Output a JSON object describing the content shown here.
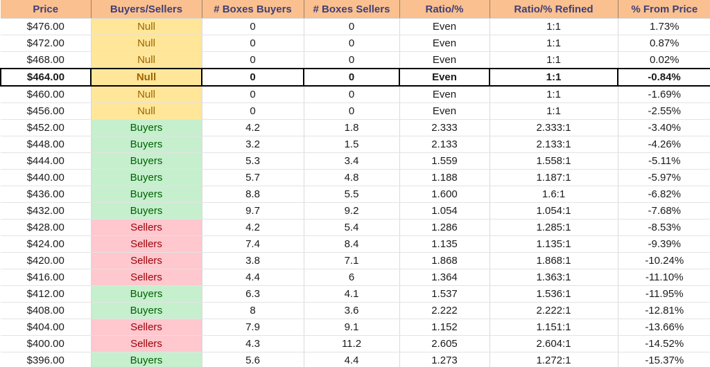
{
  "table": {
    "headers": [
      "Price",
      "Buyers/Sellers",
      "# Boxes Buyers",
      "# Boxes Sellers",
      "Ratio/%",
      "Ratio/% Refined",
      "% From Price"
    ],
    "colors": {
      "header_fill": "#FAC090",
      "header_text": "#3F3F76",
      "null_fill": "#FFE699",
      "null_text": "#9C6500",
      "buyers_fill": "#C6EFCE",
      "buyers_text": "#006100",
      "sellers_fill": "#FFC7CE",
      "sellers_text": "#9C0006",
      "highlight_border": "#000000"
    },
    "rows": [
      {
        "price": "$476.00",
        "status": "Null",
        "status_kind": "null",
        "boxes_buyers": "0",
        "boxes_sellers": "0",
        "ratio": "Even",
        "ratio_refined": "1:1",
        "from_price": "1.73%",
        "highlight": false
      },
      {
        "price": "$472.00",
        "status": "Null",
        "status_kind": "null",
        "boxes_buyers": "0",
        "boxes_sellers": "0",
        "ratio": "Even",
        "ratio_refined": "1:1",
        "from_price": "0.87%",
        "highlight": false
      },
      {
        "price": "$468.00",
        "status": "Null",
        "status_kind": "null",
        "boxes_buyers": "0",
        "boxes_sellers": "0",
        "ratio": "Even",
        "ratio_refined": "1:1",
        "from_price": "0.02%",
        "highlight": false
      },
      {
        "price": "$464.00",
        "status": "Null",
        "status_kind": "null",
        "boxes_buyers": "0",
        "boxes_sellers": "0",
        "ratio": "Even",
        "ratio_refined": "1:1",
        "from_price": "-0.84%",
        "highlight": true
      },
      {
        "price": "$460.00",
        "status": "Null",
        "status_kind": "null",
        "boxes_buyers": "0",
        "boxes_sellers": "0",
        "ratio": "Even",
        "ratio_refined": "1:1",
        "from_price": "-1.69%",
        "highlight": false
      },
      {
        "price": "$456.00",
        "status": "Null",
        "status_kind": "null",
        "boxes_buyers": "0",
        "boxes_sellers": "0",
        "ratio": "Even",
        "ratio_refined": "1:1",
        "from_price": "-2.55%",
        "highlight": false
      },
      {
        "price": "$452.00",
        "status": "Buyers",
        "status_kind": "buyers",
        "boxes_buyers": "4.2",
        "boxes_sellers": "1.8",
        "ratio": "2.333",
        "ratio_refined": "2.333:1",
        "from_price": "-3.40%",
        "highlight": false
      },
      {
        "price": "$448.00",
        "status": "Buyers",
        "status_kind": "buyers",
        "boxes_buyers": "3.2",
        "boxes_sellers": "1.5",
        "ratio": "2.133",
        "ratio_refined": "2.133:1",
        "from_price": "-4.26%",
        "highlight": false
      },
      {
        "price": "$444.00",
        "status": "Buyers",
        "status_kind": "buyers",
        "boxes_buyers": "5.3",
        "boxes_sellers": "3.4",
        "ratio": "1.559",
        "ratio_refined": "1.558:1",
        "from_price": "-5.11%",
        "highlight": false
      },
      {
        "price": "$440.00",
        "status": "Buyers",
        "status_kind": "buyers",
        "boxes_buyers": "5.7",
        "boxes_sellers": "4.8",
        "ratio": "1.188",
        "ratio_refined": "1.187:1",
        "from_price": "-5.97%",
        "highlight": false
      },
      {
        "price": "$436.00",
        "status": "Buyers",
        "status_kind": "buyers",
        "boxes_buyers": "8.8",
        "boxes_sellers": "5.5",
        "ratio": "1.600",
        "ratio_refined": "1.6:1",
        "from_price": "-6.82%",
        "highlight": false
      },
      {
        "price": "$432.00",
        "status": "Buyers",
        "status_kind": "buyers",
        "boxes_buyers": "9.7",
        "boxes_sellers": "9.2",
        "ratio": "1.054",
        "ratio_refined": "1.054:1",
        "from_price": "-7.68%",
        "highlight": false
      },
      {
        "price": "$428.00",
        "status": "Sellers",
        "status_kind": "sellers",
        "boxes_buyers": "4.2",
        "boxes_sellers": "5.4",
        "ratio": "1.286",
        "ratio_refined": "1.285:1",
        "from_price": "-8.53%",
        "highlight": false
      },
      {
        "price": "$424.00",
        "status": "Sellers",
        "status_kind": "sellers",
        "boxes_buyers": "7.4",
        "boxes_sellers": "8.4",
        "ratio": "1.135",
        "ratio_refined": "1.135:1",
        "from_price": "-9.39%",
        "highlight": false
      },
      {
        "price": "$420.00",
        "status": "Sellers",
        "status_kind": "sellers",
        "boxes_buyers": "3.8",
        "boxes_sellers": "7.1",
        "ratio": "1.868",
        "ratio_refined": "1.868:1",
        "from_price": "-10.24%",
        "highlight": false
      },
      {
        "price": "$416.00",
        "status": "Sellers",
        "status_kind": "sellers",
        "boxes_buyers": "4.4",
        "boxes_sellers": "6",
        "ratio": "1.364",
        "ratio_refined": "1.363:1",
        "from_price": "-11.10%",
        "highlight": false
      },
      {
        "price": "$412.00",
        "status": "Buyers",
        "status_kind": "buyers",
        "boxes_buyers": "6.3",
        "boxes_sellers": "4.1",
        "ratio": "1.537",
        "ratio_refined": "1.536:1",
        "from_price": "-11.95%",
        "highlight": false
      },
      {
        "price": "$408.00",
        "status": "Buyers",
        "status_kind": "buyers",
        "boxes_buyers": "8",
        "boxes_sellers": "3.6",
        "ratio": "2.222",
        "ratio_refined": "2.222:1",
        "from_price": "-12.81%",
        "highlight": false
      },
      {
        "price": "$404.00",
        "status": "Sellers",
        "status_kind": "sellers",
        "boxes_buyers": "7.9",
        "boxes_sellers": "9.1",
        "ratio": "1.152",
        "ratio_refined": "1.151:1",
        "from_price": "-13.66%",
        "highlight": false
      },
      {
        "price": "$400.00",
        "status": "Sellers",
        "status_kind": "sellers",
        "boxes_buyers": "4.3",
        "boxes_sellers": "11.2",
        "ratio": "2.605",
        "ratio_refined": "2.604:1",
        "from_price": "-14.52%",
        "highlight": false
      },
      {
        "price": "$396.00",
        "status": "Buyers",
        "status_kind": "buyers",
        "boxes_buyers": "5.6",
        "boxes_sellers": "4.4",
        "ratio": "1.273",
        "ratio_refined": "1.272:1",
        "from_price": "-15.37%",
        "highlight": false
      }
    ]
  }
}
